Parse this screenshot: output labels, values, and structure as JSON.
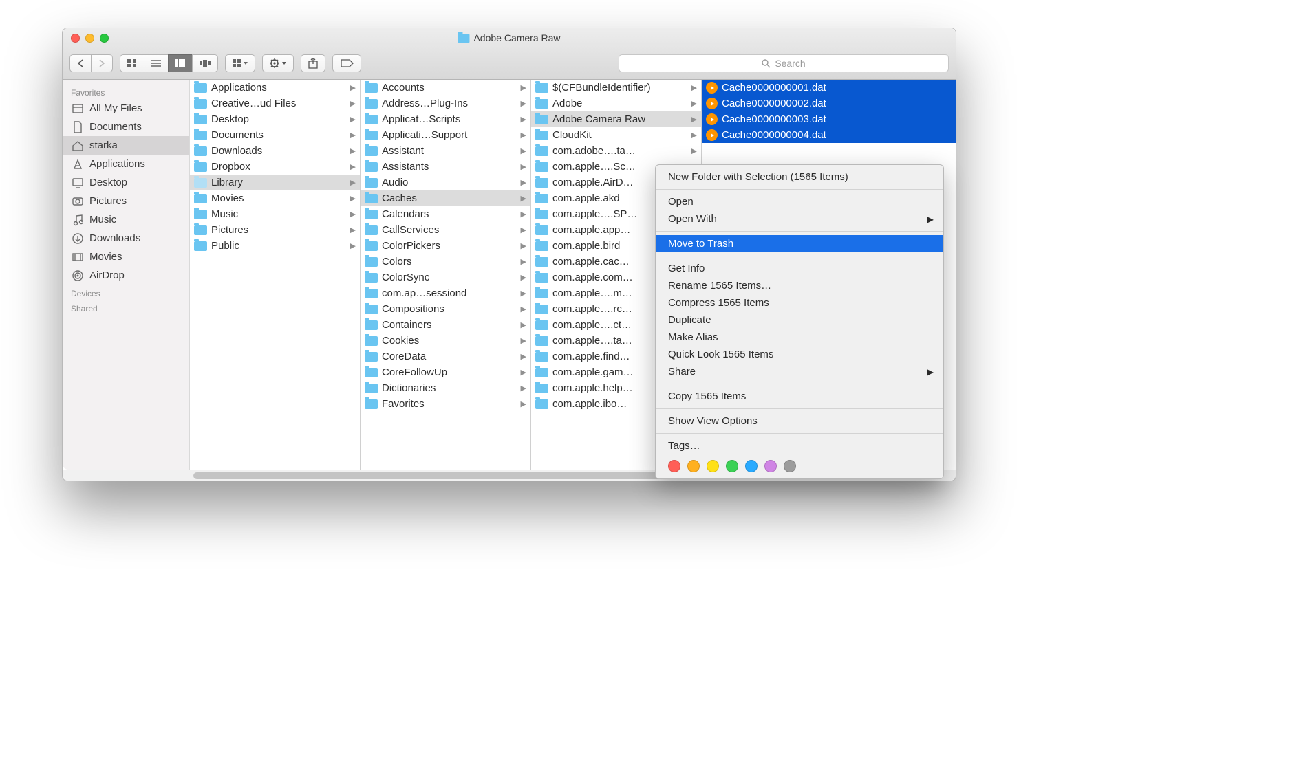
{
  "window": {
    "title": "Adobe Camera Raw"
  },
  "search": {
    "placeholder": "Search"
  },
  "sidebar": {
    "headers": {
      "favorites": "Favorites",
      "devices": "Devices",
      "shared": "Shared"
    },
    "items": [
      {
        "label": "All My Files",
        "icon": "allfiles"
      },
      {
        "label": "Documents",
        "icon": "documents"
      },
      {
        "label": "starka",
        "icon": "home",
        "selected": true
      },
      {
        "label": "Applications",
        "icon": "apps"
      },
      {
        "label": "Desktop",
        "icon": "desktop"
      },
      {
        "label": "Pictures",
        "icon": "pictures"
      },
      {
        "label": "Music",
        "icon": "music"
      },
      {
        "label": "Downloads",
        "icon": "downloads"
      },
      {
        "label": "Movies",
        "icon": "movies"
      },
      {
        "label": "AirDrop",
        "icon": "airdrop"
      }
    ]
  },
  "columns": [
    {
      "items": [
        {
          "label": "Applications",
          "folder": true,
          "has_children": true
        },
        {
          "label": "Creative…ud Files",
          "folder": true,
          "has_children": true
        },
        {
          "label": "Desktop",
          "folder": true,
          "has_children": true
        },
        {
          "label": "Documents",
          "folder": true,
          "has_children": true
        },
        {
          "label": "Downloads",
          "folder": true,
          "has_children": true
        },
        {
          "label": "Dropbox",
          "folder": true,
          "has_children": true
        },
        {
          "label": "Library",
          "folder": true,
          "has_children": true,
          "selected": true,
          "dim": true
        },
        {
          "label": "Movies",
          "folder": true,
          "has_children": true
        },
        {
          "label": "Music",
          "folder": true,
          "has_children": true
        },
        {
          "label": "Pictures",
          "folder": true,
          "has_children": true
        },
        {
          "label": "Public",
          "folder": true,
          "has_children": true
        }
      ]
    },
    {
      "items": [
        {
          "label": "Accounts",
          "folder": true,
          "has_children": true
        },
        {
          "label": "Address…Plug-Ins",
          "folder": true,
          "has_children": true
        },
        {
          "label": "Applicat…Scripts",
          "folder": true,
          "has_children": true
        },
        {
          "label": "Applicati…Support",
          "folder": true,
          "has_children": true
        },
        {
          "label": "Assistant",
          "folder": true,
          "has_children": true
        },
        {
          "label": "Assistants",
          "folder": true,
          "has_children": true
        },
        {
          "label": "Audio",
          "folder": true,
          "has_children": true
        },
        {
          "label": "Caches",
          "folder": true,
          "has_children": true,
          "selected": true
        },
        {
          "label": "Calendars",
          "folder": true,
          "has_children": true
        },
        {
          "label": "CallServices",
          "folder": true,
          "has_children": true
        },
        {
          "label": "ColorPickers",
          "folder": true,
          "has_children": true
        },
        {
          "label": "Colors",
          "folder": true,
          "has_children": true
        },
        {
          "label": "ColorSync",
          "folder": true,
          "has_children": true
        },
        {
          "label": "com.ap…sessiond",
          "folder": true,
          "has_children": true
        },
        {
          "label": "Compositions",
          "folder": true,
          "has_children": true
        },
        {
          "label": "Containers",
          "folder": true,
          "has_children": true
        },
        {
          "label": "Cookies",
          "folder": true,
          "has_children": true
        },
        {
          "label": "CoreData",
          "folder": true,
          "has_children": true
        },
        {
          "label": "CoreFollowUp",
          "folder": true,
          "has_children": true
        },
        {
          "label": "Dictionaries",
          "folder": true,
          "has_children": true
        },
        {
          "label": "Favorites",
          "folder": true,
          "has_children": true
        }
      ]
    },
    {
      "items": [
        {
          "label": "$(CFBundleIdentifier)",
          "folder": true,
          "has_children": true
        },
        {
          "label": "Adobe",
          "folder": true,
          "has_children": true
        },
        {
          "label": "Adobe Camera Raw",
          "folder": true,
          "has_children": true,
          "selected": true
        },
        {
          "label": "CloudKit",
          "folder": true,
          "has_children": true
        },
        {
          "label": "com.adobe….ta…",
          "folder": true,
          "has_children": true
        },
        {
          "label": "com.apple….Sc…",
          "folder": true,
          "has_children": true
        },
        {
          "label": "com.apple.AirD…",
          "folder": true,
          "has_children": true
        },
        {
          "label": "com.apple.akd",
          "folder": true,
          "has_children": true
        },
        {
          "label": "com.apple….SP…",
          "folder": true,
          "has_children": true
        },
        {
          "label": "com.apple.app…",
          "folder": true,
          "has_children": true
        },
        {
          "label": "com.apple.bird",
          "folder": true,
          "has_children": true
        },
        {
          "label": "com.apple.cac…",
          "folder": true,
          "has_children": true
        },
        {
          "label": "com.apple.com…",
          "folder": true,
          "has_children": true
        },
        {
          "label": "com.apple….m…",
          "folder": true,
          "has_children": true
        },
        {
          "label": "com.apple….rc…",
          "folder": true,
          "has_children": true
        },
        {
          "label": "com.apple….ct…",
          "folder": true,
          "has_children": true
        },
        {
          "label": "com.apple….ta…",
          "folder": true,
          "has_children": true
        },
        {
          "label": "com.apple.find…",
          "folder": true,
          "has_children": true
        },
        {
          "label": "com.apple.gam…",
          "folder": true,
          "has_children": true
        },
        {
          "label": "com.apple.help…",
          "folder": true,
          "has_children": true
        },
        {
          "label": "com.apple.ibo…",
          "folder": true,
          "has_children": true
        }
      ]
    },
    {
      "last": true,
      "items": [
        {
          "label": "Cache0000000001.dat",
          "file": true,
          "selected_blue": true
        },
        {
          "label": "Cache0000000002.dat",
          "file": true,
          "selected_blue": true
        },
        {
          "label": "Cache0000000003.dat",
          "file": true,
          "selected_blue": true
        },
        {
          "label": "Cache0000000004.dat",
          "file": true,
          "selected_blue": true
        }
      ]
    }
  ],
  "context_menu": {
    "items": [
      {
        "label": "New Folder with Selection (1565 Items)"
      },
      {
        "sep": true
      },
      {
        "label": "Open"
      },
      {
        "label": "Open With",
        "submenu": true
      },
      {
        "sep": true
      },
      {
        "label": "Move to Trash",
        "highlight": true
      },
      {
        "sep": true
      },
      {
        "label": "Get Info"
      },
      {
        "label": "Rename 1565 Items…"
      },
      {
        "label": "Compress 1565 Items"
      },
      {
        "label": "Duplicate"
      },
      {
        "label": "Make Alias"
      },
      {
        "label": "Quick Look 1565 Items"
      },
      {
        "label": "Share",
        "submenu": true
      },
      {
        "sep": true
      },
      {
        "label": "Copy 1565 Items"
      },
      {
        "sep": true
      },
      {
        "label": "Show View Options"
      },
      {
        "sep": true
      },
      {
        "label": "Tags…"
      }
    ],
    "tag_colors": [
      "#ff5f57",
      "#ffb01f",
      "#ffe016",
      "#3bd155",
      "#28aaff",
      "#d085e5",
      "#9c9c9c"
    ]
  }
}
